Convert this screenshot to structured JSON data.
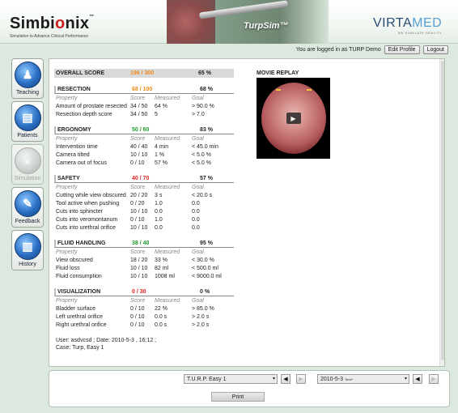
{
  "header": {
    "brand_name_prefix": "Simbi",
    "brand_name_o": "o",
    "brand_name_suffix": "nix",
    "brand_tm": "™",
    "brand_tagline": "Simulation to Advance Clinical Performance",
    "product": "TurpSim™",
    "partner_name_a": "VIRTA",
    "partner_name_b": "MED",
    "partner_tagline": "WE SIMULATE REALITY"
  },
  "userbar": {
    "logged_in_text": "You are logged in as TURP Demo",
    "edit_profile": "Edit Profile",
    "logout": "Logout"
  },
  "sidebar": {
    "items": [
      {
        "label": "Teaching",
        "icon": "teacher-icon",
        "glyph": "♟"
      },
      {
        "label": "Patients",
        "icon": "clipboard-icon",
        "glyph": "▤"
      },
      {
        "label": "Simulation",
        "icon": "simulation-icon",
        "glyph": "●"
      },
      {
        "label": "Feedback",
        "icon": "feedback-pen-icon",
        "glyph": "✎"
      },
      {
        "label": "History",
        "icon": "bar-chart-icon",
        "glyph": "▥"
      }
    ]
  },
  "report": {
    "overall": {
      "label": "OVERALL SCORE",
      "score": "196 / 300",
      "percent": "65 %"
    },
    "columns": {
      "property": "Property",
      "score": "Score",
      "measured": "Measured",
      "goal": "Goal"
    },
    "sections": [
      {
        "title": "RESECTION",
        "score": "68 / 100",
        "percent": "68 %",
        "score_color": "orange",
        "rows": [
          {
            "property": "Amount of prostate resected",
            "score": "34 / 50",
            "measured": "64 %",
            "goal": "> 90.0 %"
          },
          {
            "property": "Resection depth score",
            "score": "34 / 50",
            "measured": "5",
            "goal": "> 7.0"
          }
        ]
      },
      {
        "title": "ERGONOMY",
        "score": "50 / 60",
        "percent": "83 %",
        "score_color": "green",
        "rows": [
          {
            "property": "Intervention time",
            "score": "40 / 40",
            "measured": "4 min",
            "goal": "< 45.0 min"
          },
          {
            "property": "Camera tilted",
            "score": "10 / 10",
            "measured": "1 %",
            "goal": "< 5.0 %"
          },
          {
            "property": "Camera out of focus",
            "score": "0 / 10",
            "measured": "57 %",
            "goal": "< 5.0 %"
          }
        ]
      },
      {
        "title": "SAFETY",
        "score": "40 / 70",
        "percent": "57 %",
        "score_color": "red",
        "rows": [
          {
            "property": "Cutting while view obscured",
            "score": "20 / 20",
            "measured": "3 s",
            "goal": "< 20.0 s"
          },
          {
            "property": "Tool active when pushing",
            "score": "0 / 20",
            "measured": "1.0",
            "goal": "0.0"
          },
          {
            "property": "Cuts into sphincter",
            "score": "10 / 10",
            "measured": "0.0",
            "goal": "0.0"
          },
          {
            "property": "Cuts into veromontanum",
            "score": "0 / 10",
            "measured": "1.0",
            "goal": "0.0"
          },
          {
            "property": "Cuts into urethral orifice",
            "score": "10 / 10",
            "measured": "0.0",
            "goal": "0.0"
          }
        ]
      },
      {
        "title": "FLUID HANDLING",
        "score": "38 / 40",
        "percent": "95 %",
        "score_color": "green",
        "rows": [
          {
            "property": "View obscured",
            "score": "18 / 20",
            "measured": "33 %",
            "goal": "< 30.0 %"
          },
          {
            "property": "Fluid loss",
            "score": "10 / 10",
            "measured": "82 ml",
            "goal": "< 500.0 ml"
          },
          {
            "property": "Fluid consumption",
            "score": "10 / 10",
            "measured": "1008 ml",
            "goal": "< 9000.0 ml"
          }
        ]
      },
      {
        "title": "VISUALIZATION",
        "score": "0 / 30",
        "percent": "0 %",
        "score_color": "red",
        "rows": [
          {
            "property": "Bladder surface",
            "score": "0 / 10",
            "measured": "22 %",
            "goal": "> 85.0 %"
          },
          {
            "property": "Left urethral orifice",
            "score": "0 / 10",
            "measured": "0.0 s",
            "goal": "> 2.0 s"
          },
          {
            "property": "Right urethral orifice",
            "score": "0 / 10",
            "measured": "0.0 s",
            "goal": "> 2.0 s"
          }
        ]
      }
    ],
    "footer": {
      "user_line": "User: asdvcsd ; Date: 2010-5-3 , 16:12 ;",
      "case_line": "Case: Turp, Easy 1"
    }
  },
  "movie": {
    "title": "MOVIE REPLAY",
    "play_glyph": "▶"
  },
  "bottom": {
    "case_select": "T.U.R.P. Easy 1",
    "date_select": "2010-5-3",
    "date_select_suffix": "Time*",
    "print": "Print",
    "arrow_down": "▾",
    "arrow_prev": "◀",
    "arrow_next": "▶"
  },
  "colors": {
    "green": "#1c9a2a",
    "orange": "#f08a17",
    "red": "#e02020",
    "background": "#dde9df",
    "icon_blue": "#2a6fc4"
  }
}
